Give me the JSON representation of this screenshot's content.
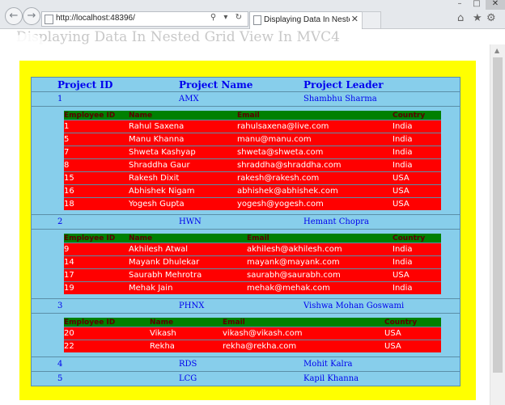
{
  "browser": {
    "url": "http://localhost:48396/",
    "tab_title": "Displaying Data In Nested G...",
    "tab_close": "✕",
    "back_icon": "←",
    "forward_icon": "→",
    "address_tools": "⚲ ▾ ↻",
    "window_minimize": "–",
    "window_maximize": "□",
    "window_close": "✕",
    "home_icon": "⌂",
    "star_icon": "★",
    "gear_icon": "⚙"
  },
  "page": {
    "heading": "Displaying Data In Nested Grid View In MVC4",
    "colors": {
      "background": "#ffff00",
      "grid": "#87ceeb",
      "inner_header": "#008000",
      "inner_rows": "#ff0000",
      "link_text": "#0000ee"
    }
  },
  "outer_grid": {
    "headers": [
      "Project ID",
      "Project Name",
      "Project Leader"
    ],
    "projects": [
      {
        "id": "1",
        "name": "AMX",
        "leader": "Shambhu Sharma",
        "inner_headers": [
          "Employee ID",
          "Name",
          "Email",
          "Country"
        ],
        "employees": [
          [
            "1",
            "Rahul Saxena",
            "rahulsaxena@live.com",
            "India"
          ],
          [
            "5",
            "Manu Khanna",
            "manu@manu.com",
            "India"
          ],
          [
            "7",
            "Shweta Kashyap",
            "shweta@shweta.com",
            "India"
          ],
          [
            "8",
            "Shraddha Gaur",
            "shraddha@shraddha.com",
            "India"
          ],
          [
            "15",
            "Rakesh Dixit",
            "rakesh@rakesh.com",
            "USA"
          ],
          [
            "16",
            "Abhishek Nigam",
            "abhishek@abhishek.com",
            "USA"
          ],
          [
            "18",
            "Yogesh Gupta",
            "yogesh@yogesh.com",
            "USA"
          ]
        ]
      },
      {
        "id": "2",
        "name": "HWN",
        "leader": "Hemant Chopra",
        "inner_headers": [
          "Employee ID",
          "Name",
          "Email",
          "Country"
        ],
        "employees": [
          [
            "9",
            "Akhilesh Atwal",
            "akhilesh@akhilesh.com",
            "India"
          ],
          [
            "14",
            "Mayank Dhulekar",
            "mayank@mayank.com",
            "India"
          ],
          [
            "17",
            "Saurabh Mehrotra",
            "saurabh@saurabh.com",
            "USA"
          ],
          [
            "19",
            "Mehak Jain",
            "mehak@mehak.com",
            "India"
          ]
        ]
      },
      {
        "id": "3",
        "name": "PHNX",
        "leader": "Vishwa Mohan Goswami",
        "inner_headers": [
          "Employee ID",
          "Name",
          "Email",
          "Country"
        ],
        "employees": [
          [
            "20",
            "Vikash",
            "vikash@vikash.com",
            "USA"
          ],
          [
            "22",
            "Rekha",
            "rekha@rekha.com",
            "USA"
          ]
        ]
      },
      {
        "id": "4",
        "name": "RDS",
        "leader": "Mohit Kalra",
        "employees": []
      },
      {
        "id": "5",
        "name": "LCG",
        "leader": "Kapil Khanna",
        "employees": []
      }
    ]
  }
}
